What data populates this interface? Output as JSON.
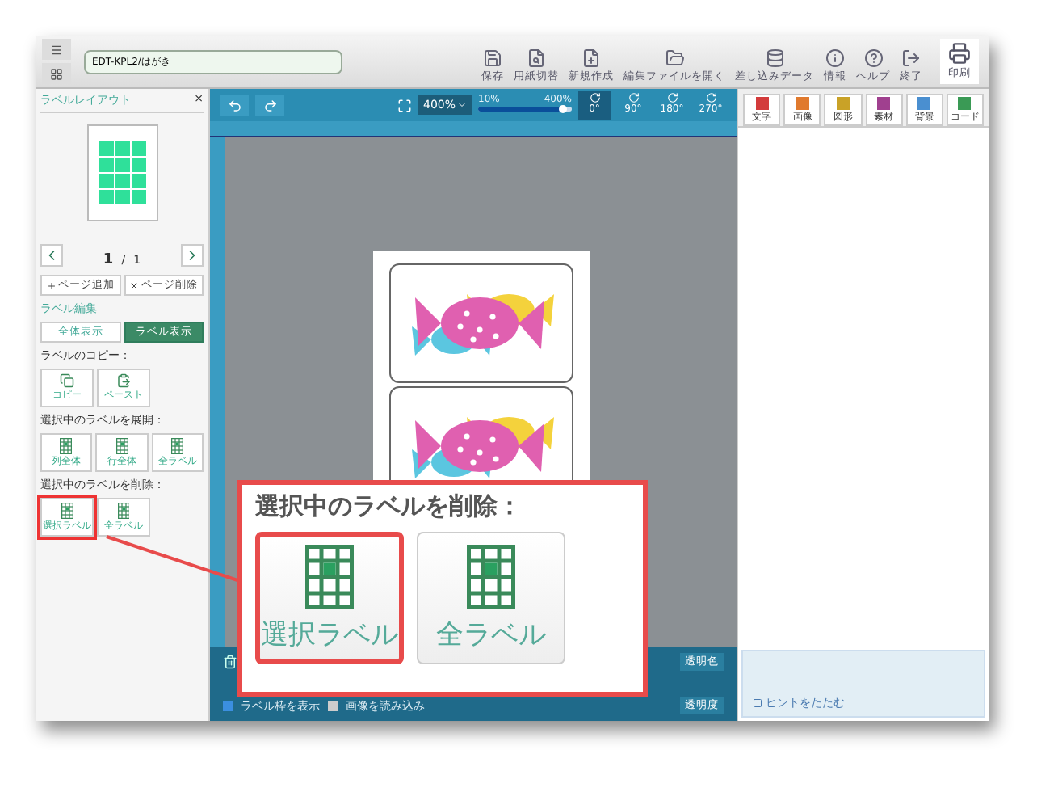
{
  "toolbar": {
    "document": "EDT-KPL2/はがき",
    "tools": [
      {
        "kind": "save",
        "label": "保存"
      },
      {
        "kind": "preview",
        "label": "用紙切替"
      },
      {
        "kind": "new",
        "label": "新規作成"
      },
      {
        "kind": "open",
        "label": "編集ファイルを開く"
      },
      {
        "kind": "data",
        "label": "差し込みデータ"
      },
      {
        "kind": "info",
        "label": "情報"
      },
      {
        "kind": "help",
        "label": "ヘルプ"
      },
      {
        "kind": "exit",
        "label": "終了"
      }
    ],
    "print": "印刷"
  },
  "left_panel": {
    "title": "ラベルレイアウト",
    "close": "×",
    "page": "1",
    "separator": "/",
    "pages": "1",
    "add_page": "ページ追加",
    "delete_page": "ページ削除",
    "edit_heading": "ラベル編集",
    "view_buttons": [
      {
        "label": "全体表示",
        "selected": false
      },
      {
        "label": "ラベル表示",
        "selected": true
      }
    ],
    "copy_heading": "ラベルのコピー：",
    "copy_buttons": [
      "コピー",
      "ペースト"
    ],
    "expand_heading": "選択中のラベルを展開：",
    "expand_buttons": [
      "列全体",
      "行全体",
      "全ラベル"
    ],
    "delete_heading": "選択中のラベルを削除：",
    "delete_buttons": [
      "選択ラベル",
      "全ラベル"
    ]
  },
  "canvas": {
    "zoom": "400%",
    "zoom_min": "10%",
    "zoom_max": "400%",
    "level": 0.92,
    "rotations": [
      {
        "label": "0°",
        "selected": true
      },
      {
        "label": "90°",
        "selected": false
      },
      {
        "label": "180°",
        "selected": false
      },
      {
        "label": "270°",
        "selected": false
      }
    ],
    "show_frame": {
      "label": "ラベル枠を表示",
      "checked": true
    },
    "load_image": {
      "label": "画像を読み込み",
      "checked": false
    },
    "opacity": "透明度",
    "transparent": "透明色"
  },
  "object_tabs": [
    {
      "label": "文字",
      "color": "#d33b3b"
    },
    {
      "label": "画像",
      "color": "#e07a2e"
    },
    {
      "label": "図形",
      "color": "#c9a227"
    },
    {
      "label": "素材",
      "color": "#a0408f"
    },
    {
      "label": "背景",
      "color": "#4a8fd0"
    },
    {
      "label": "コード",
      "color": "#3a9a55"
    }
  ],
  "hint": {
    "collapse": "ヒントをたたむ"
  },
  "callout": {
    "heading": "選択中のラベルを削除：",
    "buttons": [
      {
        "label": "選択ラベル",
        "selected": true
      },
      {
        "label": "全ラベル",
        "selected": false
      }
    ]
  }
}
